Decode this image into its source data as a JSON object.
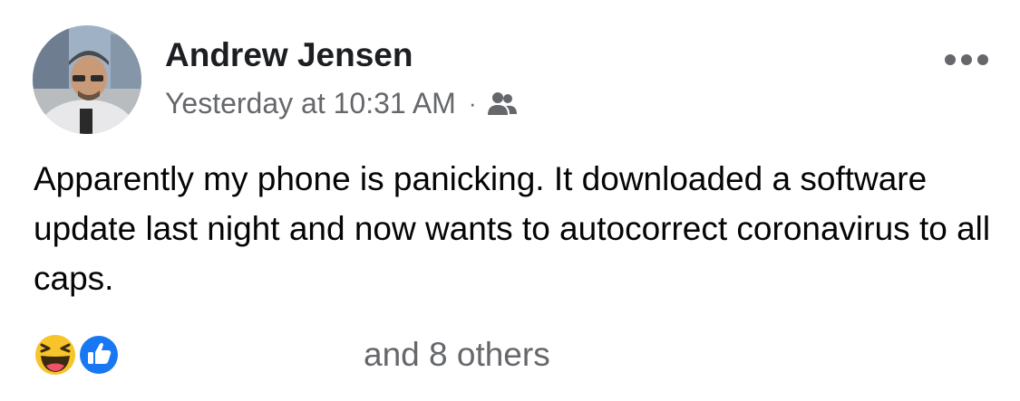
{
  "post": {
    "author": "Andrew Jensen",
    "timestamp": "Yesterday at 10:31 AM",
    "separator": "·",
    "audience_icon": "friends-icon",
    "more_icon": "more-options-icon",
    "text": "Apparently my phone is panicking. It downloaded a software update last night and now wants to autocorrect coronavirus to all caps.",
    "reactions": {
      "icons": [
        "haha-icon",
        "like-icon"
      ],
      "summary": "and 8 others"
    }
  },
  "colors": {
    "author": "#1c1e21",
    "meta": "#65676b",
    "body_text": "#050505",
    "like_blue": "#1877f2",
    "haha_yellow": "#f7c42a"
  }
}
